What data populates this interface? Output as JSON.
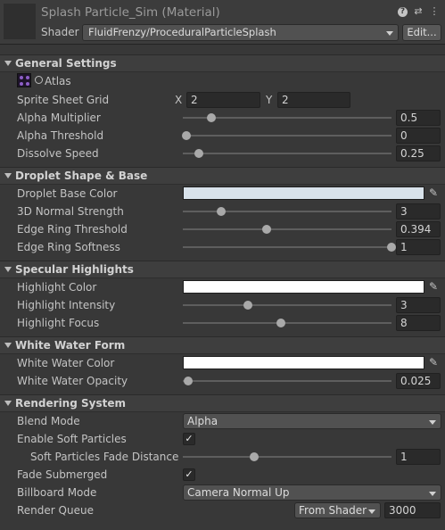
{
  "header": {
    "title": "Splash Particle_Sim (Material)",
    "shader_label": "Shader",
    "shader_value": "FluidFrenzy/ProceduralParticleSplash",
    "edit_label": "Edit..."
  },
  "sections": {
    "general": {
      "title": "General Settings",
      "atlas_label": "Atlas",
      "sprite_grid": {
        "label": "Sprite Sheet Grid",
        "x_label": "X",
        "x": "2",
        "y_label": "Y",
        "y": "2"
      },
      "alpha_multiplier": {
        "label": "Alpha Multiplier",
        "value": "0.5",
        "slider": 0.12
      },
      "alpha_threshold": {
        "label": "Alpha Threshold",
        "value": "0",
        "slider": 0.0
      },
      "dissolve_speed": {
        "label": "Dissolve Speed",
        "value": "0.25",
        "slider": 0.06
      }
    },
    "droplet": {
      "title": "Droplet Shape & Base",
      "base_color": {
        "label": "Droplet Base Color",
        "color": "#d8e2ea"
      },
      "normal_strength": {
        "label": "3D Normal Strength",
        "value": "3",
        "slider": 0.17
      },
      "edge_threshold": {
        "label": "Edge Ring Threshold",
        "value": "0.394",
        "slider": 0.39
      },
      "edge_softness": {
        "label": "Edge Ring Softness",
        "value": "1",
        "slider": 1.0
      }
    },
    "specular": {
      "title": "Specular Highlights",
      "highlight_color": {
        "label": "Highlight Color",
        "color": "#ffffff"
      },
      "highlight_intensity": {
        "label": "Highlight Intensity",
        "value": "3",
        "slider": 0.3
      },
      "highlight_focus": {
        "label": "Highlight Focus",
        "value": "8",
        "slider": 0.46
      }
    },
    "whitewater": {
      "title": "White Water Form",
      "color": {
        "label": "White Water Color",
        "color": "#ffffff"
      },
      "opacity": {
        "label": "White Water Opacity",
        "value": "0.025",
        "slider": 0.01
      }
    },
    "rendering": {
      "title": "Rendering System",
      "blend_mode": {
        "label": "Blend Mode",
        "value": "Alpha"
      },
      "soft_particles": {
        "label": "Enable Soft Particles",
        "checked": true
      },
      "soft_distance": {
        "label": "Soft Particles Fade Distance",
        "value": "1",
        "slider": 0.33
      },
      "fade_submerged": {
        "label": "Fade Submerged",
        "checked": true
      },
      "billboard_mode": {
        "label": "Billboard Mode",
        "value": "Camera Normal Up"
      },
      "render_queue": {
        "label": "Render Queue",
        "source": "From Shader",
        "value": "3000"
      }
    }
  },
  "icons": {
    "help": "?",
    "settings": "⇄",
    "more": "⋮",
    "checkmark": "✓",
    "picker": "eyedropper-icon"
  },
  "colors": {
    "background": "#383838",
    "section_header": "#3e3e3e",
    "field": "#2a2a2a",
    "text": "#c4c4c4"
  }
}
